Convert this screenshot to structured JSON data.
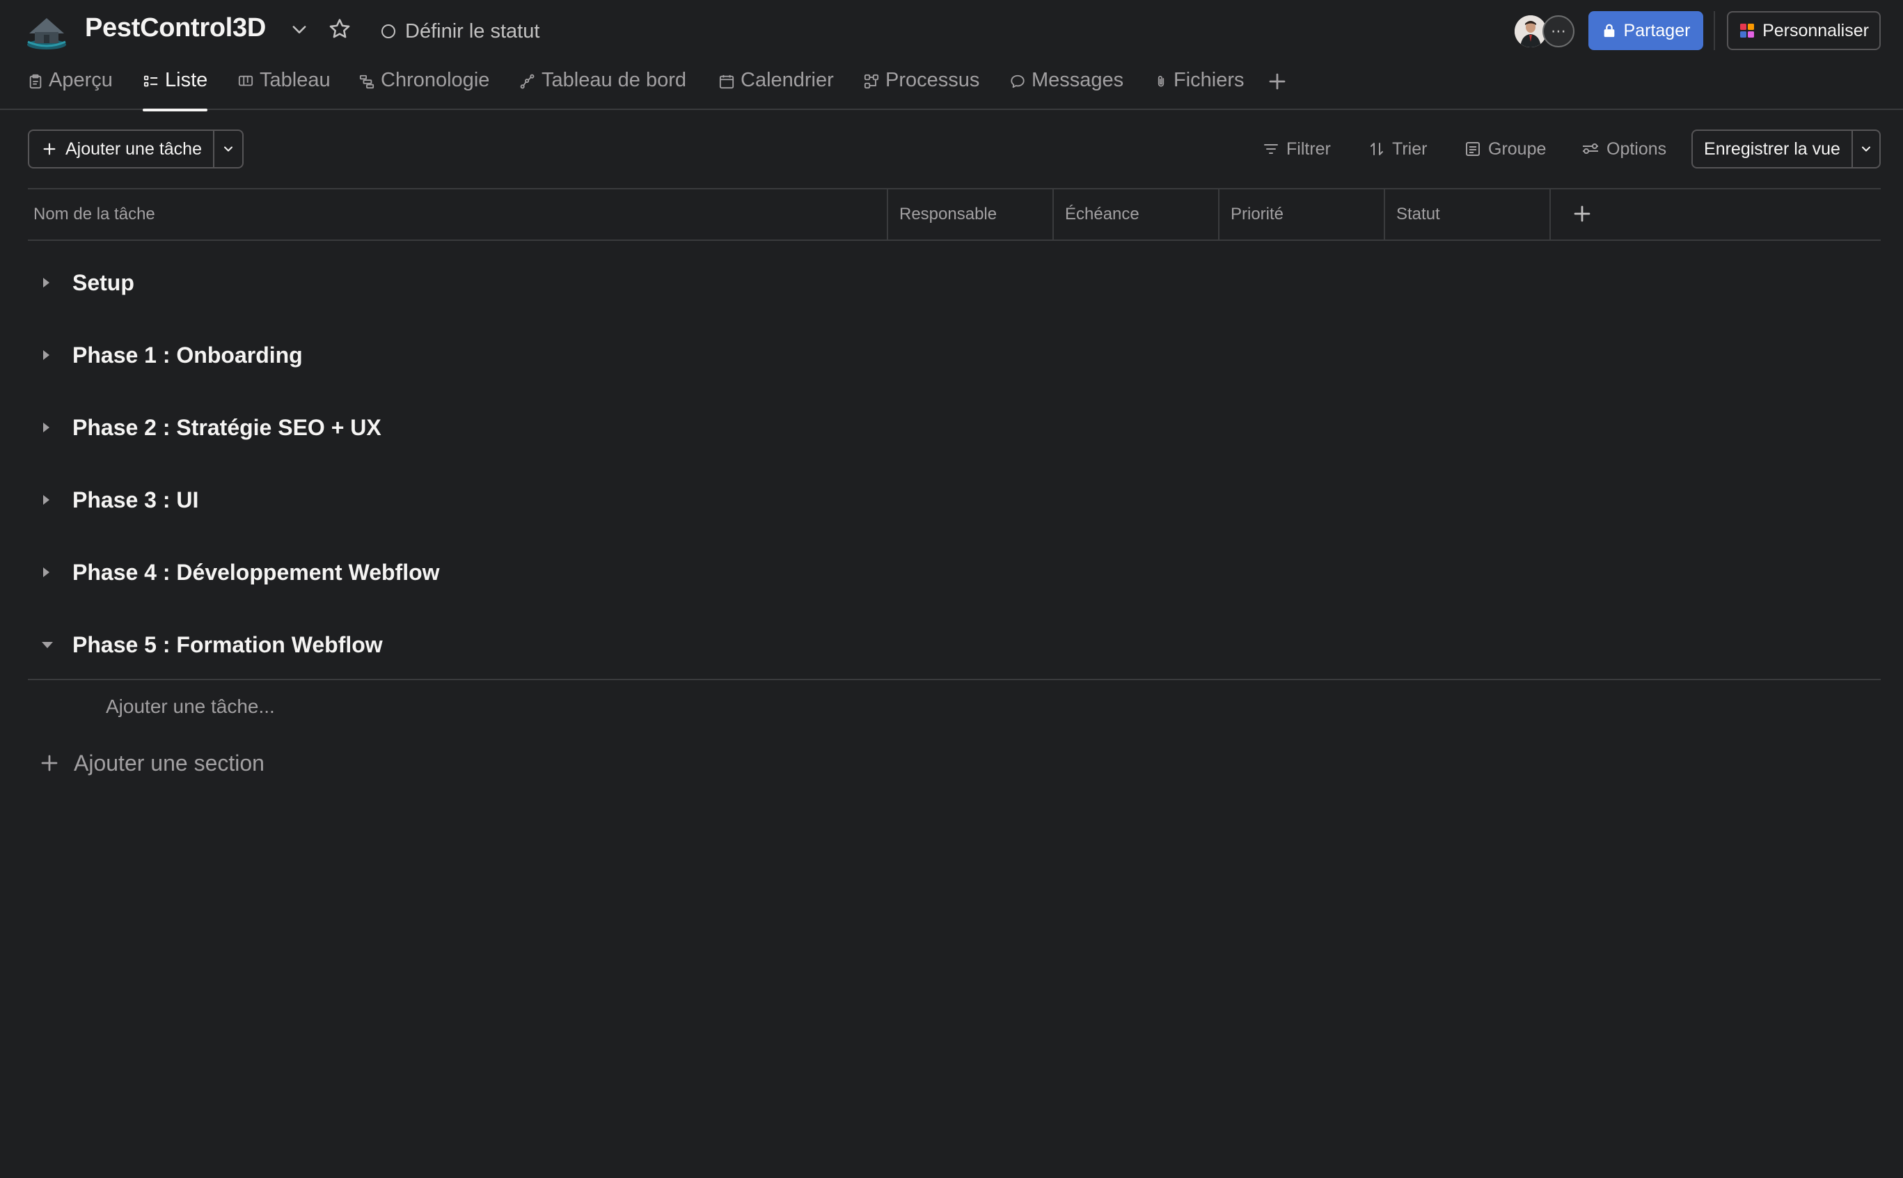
{
  "header": {
    "project_title": "PestControl3D",
    "status_label": "Définir le statut",
    "members_more": "⋯",
    "share_label": "Partager",
    "customize_label": "Personnaliser"
  },
  "tabs": [
    {
      "label": "Aperçu",
      "icon": "clipboard-icon"
    },
    {
      "label": "Liste",
      "icon": "list-icon",
      "active": true
    },
    {
      "label": "Tableau",
      "icon": "board-icon"
    },
    {
      "label": "Chronologie",
      "icon": "timeline-icon"
    },
    {
      "label": "Tableau de bord",
      "icon": "dashboard-icon"
    },
    {
      "label": "Calendrier",
      "icon": "calendar-icon"
    },
    {
      "label": "Processus",
      "icon": "workflow-icon"
    },
    {
      "label": "Messages",
      "icon": "message-icon"
    },
    {
      "label": "Fichiers",
      "icon": "paperclip-icon"
    }
  ],
  "toolbar": {
    "add_task_label": "Ajouter une tâche",
    "filter_label": "Filtrer",
    "sort_label": "Trier",
    "group_label": "Groupe",
    "options_label": "Options",
    "save_view_label": "Enregistrer la vue"
  },
  "table": {
    "columns": [
      "Nom de la tâche",
      "Responsable",
      "Échéance",
      "Priorité",
      "Statut"
    ]
  },
  "sections": [
    {
      "name": "Setup",
      "expanded": false
    },
    {
      "name": "Phase 1 : Onboarding",
      "expanded": false
    },
    {
      "name": "Phase 2 : Stratégie SEO + UX",
      "expanded": false
    },
    {
      "name": "Phase 3 : UI",
      "expanded": false
    },
    {
      "name": "Phase 4 : Développement Webflow",
      "expanded": false
    },
    {
      "name": "Phase 5 : Formation Webflow",
      "expanded": true
    }
  ],
  "add_task_placeholder": "Ajouter une tâche...",
  "add_section_label": "Ajouter une section",
  "colors": {
    "background": "#1e1f21",
    "accent": "#4573d2",
    "border": "#3a3b3d",
    "text_primary": "#f5f4f3",
    "text_secondary": "#a2a0a2"
  }
}
